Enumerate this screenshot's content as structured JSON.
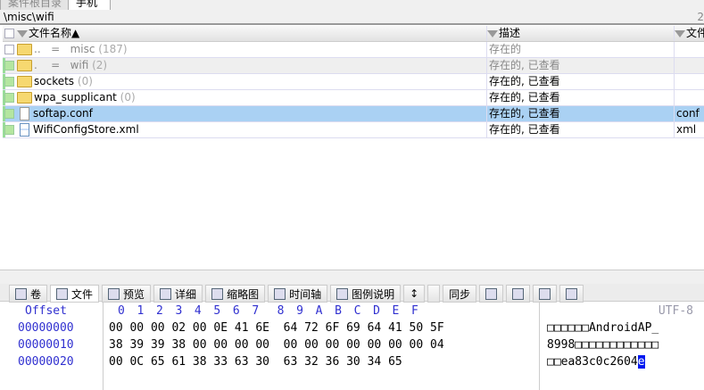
{
  "tabs": [
    "案件根目录",
    "手机"
  ],
  "path": "\\misc\\wifi",
  "path_count": "2",
  "columns": {
    "name": "文件名称▲",
    "desc": "描述",
    "ext": "文件"
  },
  "rows": [
    {
      "name": "..   =   misc",
      "count": "(187)",
      "desc": "存在的",
      "ext": "",
      "type": "folder",
      "style": "gray"
    },
    {
      "name": ".    =   wifi",
      "count": "(2)",
      "desc": "存在的, 已查看",
      "ext": "",
      "type": "folder",
      "style": "gray alt green"
    },
    {
      "name": "sockets",
      "count": "(0)",
      "desc": "存在的, 已查看",
      "ext": "",
      "type": "folder",
      "style": "green"
    },
    {
      "name": "wpa_supplicant",
      "count": "(0)",
      "desc": "存在的, 已查看",
      "ext": "",
      "type": "folder",
      "style": "green"
    },
    {
      "name": "softap.conf",
      "count": "",
      "desc": "存在的, 已查看",
      "ext": "conf",
      "type": "file",
      "style": "sel green"
    },
    {
      "name": "WifiConfigStore.xml",
      "count": "",
      "desc": "存在的, 已查看",
      "ext": "xml",
      "type": "xml",
      "style": "green"
    }
  ],
  "toolbar": [
    "卷",
    "文件",
    "预览",
    "详细",
    "缩略图",
    "时间轴",
    "图例说明",
    "↕",
    "",
    "同步"
  ],
  "hex": {
    "offset_label": "Offset",
    "header": "0  1  2  3  4  5  6  7   8  9  A  B  C  D  E  F",
    "encoding": "UTF-8",
    "offsets": [
      "00000000",
      "00000010",
      "00000020"
    ],
    "bytes": [
      "00 00 00 02 00 0E 41 6E  64 72 6F 69 64 41 50 5F",
      "38 39 39 38 00 00 00 00  00 00 00 00 00 00 00 04",
      "00 0C 65 61 38 33 63 30  63 32 36 30 34 65"
    ],
    "text": [
      "□□□□□□AndroidAP_",
      "8998□□□□□□□□□□□□",
      "□□ea83c0c2604"
    ],
    "caret_char": "e"
  }
}
